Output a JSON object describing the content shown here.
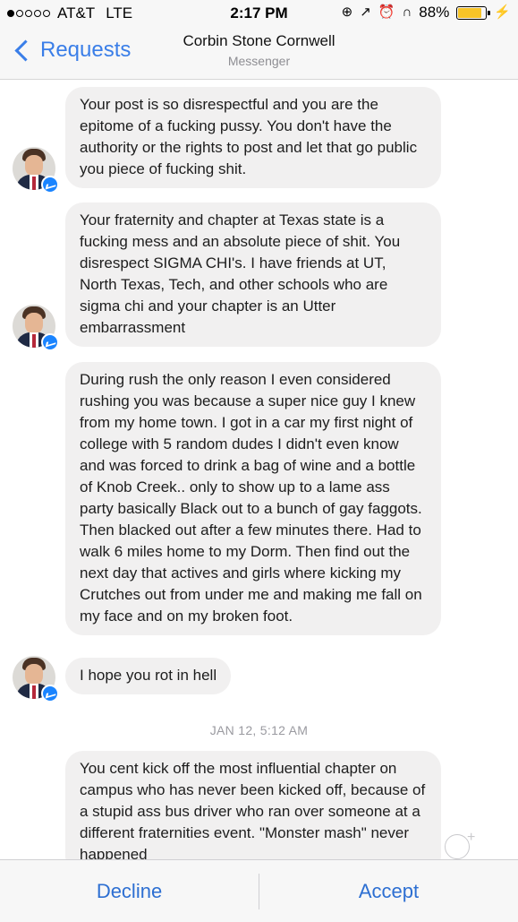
{
  "status_bar": {
    "carrier": "AT&T",
    "network": "LTE",
    "time": "2:17 PM",
    "battery_percent": "88%",
    "battery_level": 0.88,
    "icons": [
      "signal-dots",
      "lock-rotation-icon",
      "location-arrow-icon",
      "alarm-icon",
      "headphones-icon",
      "battery-icon",
      "charging-bolt-icon"
    ]
  },
  "nav": {
    "back_label": "Requests",
    "title": "Corbin Stone Cornwell",
    "subtitle": "Messenger"
  },
  "messages": [
    {
      "text": "Your post is so disrespectful and you are the epitome of a fucking pussy. You don't have the authority or the rights to post and let that go public you piece of fucking shit."
    },
    {
      "text": "Your fraternity and chapter at Texas state is a fucking mess and an absolute piece of shit. You disrespect SIGMA CHI's. I have friends at UT, North Texas, Tech, and other schools who are sigma chi and your chapter is an Utter embarrassment"
    },
    {
      "text": "During rush the only reason I even considered rushing you was because a super nice guy I knew from my home town. I got in a car my first night of college with 5 random dudes I didn't even know and was forced to drink a bag of wine and a bottle of Knob Creek.. only to show up to a lame ass party basically Black out to a bunch of gay faggots. Then blacked out after a few minutes there. Had to walk 6 miles home to my Dorm. Then find out the next day that actives and girls where kicking my Crutches out from under me and making me fall on my face and on my broken foot."
    },
    {
      "text": "I hope you rot in hell"
    },
    {
      "text": "You cent kick off the most influential chapter on campus who has never been kicked off, because of  a stupid ass bus driver who ran over someone at a different fraternities event. \"Monster mash\" never happened"
    }
  ],
  "timestamp": "JAN 12, 5:12 AM",
  "actions": {
    "decline_label": "Decline",
    "accept_label": "Accept"
  },
  "colors": {
    "accent": "#3a7ee8",
    "bubble": "#f1f0f0",
    "messenger_badge": "#1a84ff",
    "battery": "#f7c428"
  }
}
